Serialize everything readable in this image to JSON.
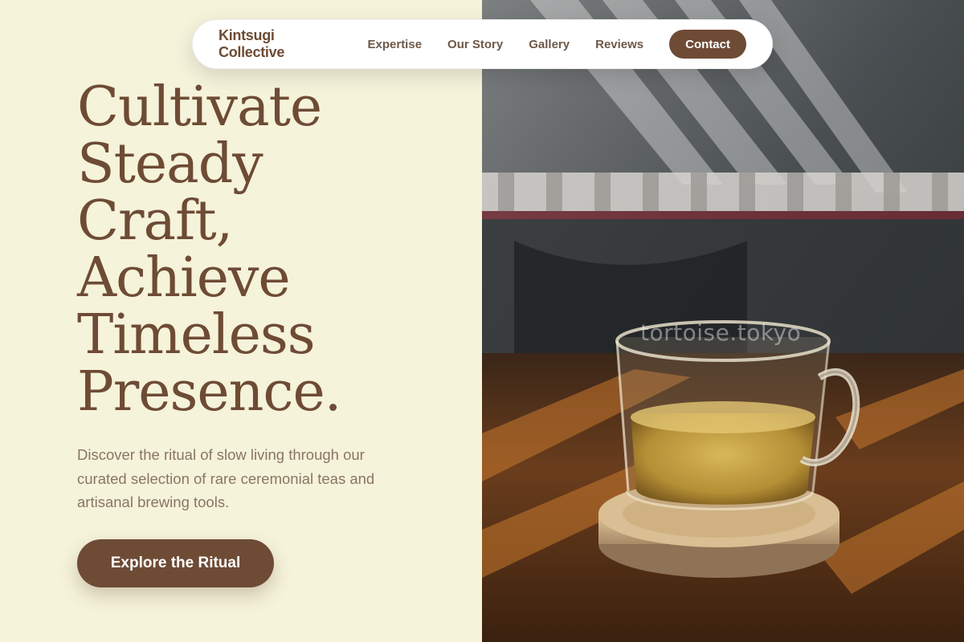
{
  "nav": {
    "brand": "Kintsugi Collective",
    "links": [
      "Expertise",
      "Our Story",
      "Gallery",
      "Reviews"
    ],
    "contact_label": "Contact"
  },
  "hero": {
    "headline_lines": [
      "Cultivate",
      "Steady",
      "Craft,",
      "Achieve",
      "Timeless",
      "Presence."
    ],
    "subtext": "Discover the ritual of slow living through our curated selection of rare ceremonial teas and artisanal brewing tools.",
    "cta_label": "Explore the Ritual"
  },
  "image": {
    "watermark": "tortoise.tokyo",
    "subject": "glass-tea-cup-on-wooden-coaster"
  },
  "colors": {
    "background": "#f5f3da",
    "accent": "#6e4b35",
    "body_text": "#8a7565"
  }
}
